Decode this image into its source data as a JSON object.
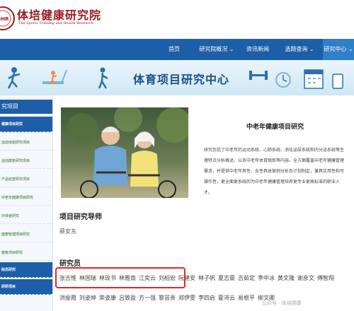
{
  "header": {
    "title": "体培健康研究院",
    "subtitle": "The Sports Training and Health Research"
  },
  "nav": {
    "items": [
      {
        "label": "首页"
      },
      {
        "label": "研究院概况 ⌄"
      },
      {
        "label": "资讯新闻"
      },
      {
        "label": "选题查询 ⌄"
      },
      {
        "label": "研究中心 ⌄",
        "active": true
      }
    ]
  },
  "banner": {
    "title": "体育项目研究中心"
  },
  "sidebar": {
    "heading": "究项目",
    "items": [
      {
        "label": "健康项目研究",
        "active": true
      },
      {
        "label": "运动体能研究项目"
      },
      {
        "label": "运动康复研究项目"
      },
      {
        "label": "产品检查研究项目"
      },
      {
        "label": "中老年健康项目研究"
      },
      {
        "label": "外体者研究"
      },
      {
        "label": "健康管理项目研究"
      },
      {
        "label": "康复项目研究"
      },
      {
        "label": "院员研究",
        "active": true
      },
      {
        "label": "研研项目"
      }
    ]
  },
  "content": {
    "section_title": "中老年健康项目研究",
    "description": "研究包括了中老年的运动系统、心肺系统、消化泌尿系统和内分泌系统等生理特点分析概述，以及中老年体育锻炼等内容。全方面覆盖中老年健康管理需求，并提供中老年男性、女性具体案例分析及计划制定，兼具实用性和可操作性，更全面更系统的为中老年健康管理培养更专业更高标准的职业人才。",
    "mentor_label": "项目研究导师",
    "mentor_name": "蔡安东",
    "researchers_label": "研究员",
    "researchers_row1": [
      "张吉惟",
      "林国瑞",
      "林玫书",
      "林雅南",
      "江奕云",
      "刘柏宏",
      "阮建安",
      "林子帆",
      "夏志豪",
      "吉茹定",
      "李中冰",
      "黄文隆",
      "谢彦文",
      "傅智翔"
    ],
    "researchers_row2": [
      "洪振霞",
      "刘姿婷",
      "荣姿康",
      "吕致盈",
      "方一强",
      "黎芸贵",
      "郑伊雯",
      "李四启",
      "霍沛云",
      "易根平",
      "柳文卿"
    ]
  },
  "watermark": "公众号 · 体培健康",
  "colors": {
    "nav_bg": "#1d5ea8",
    "brand_red": "#9b1c22",
    "highlight": "#e0262c"
  }
}
